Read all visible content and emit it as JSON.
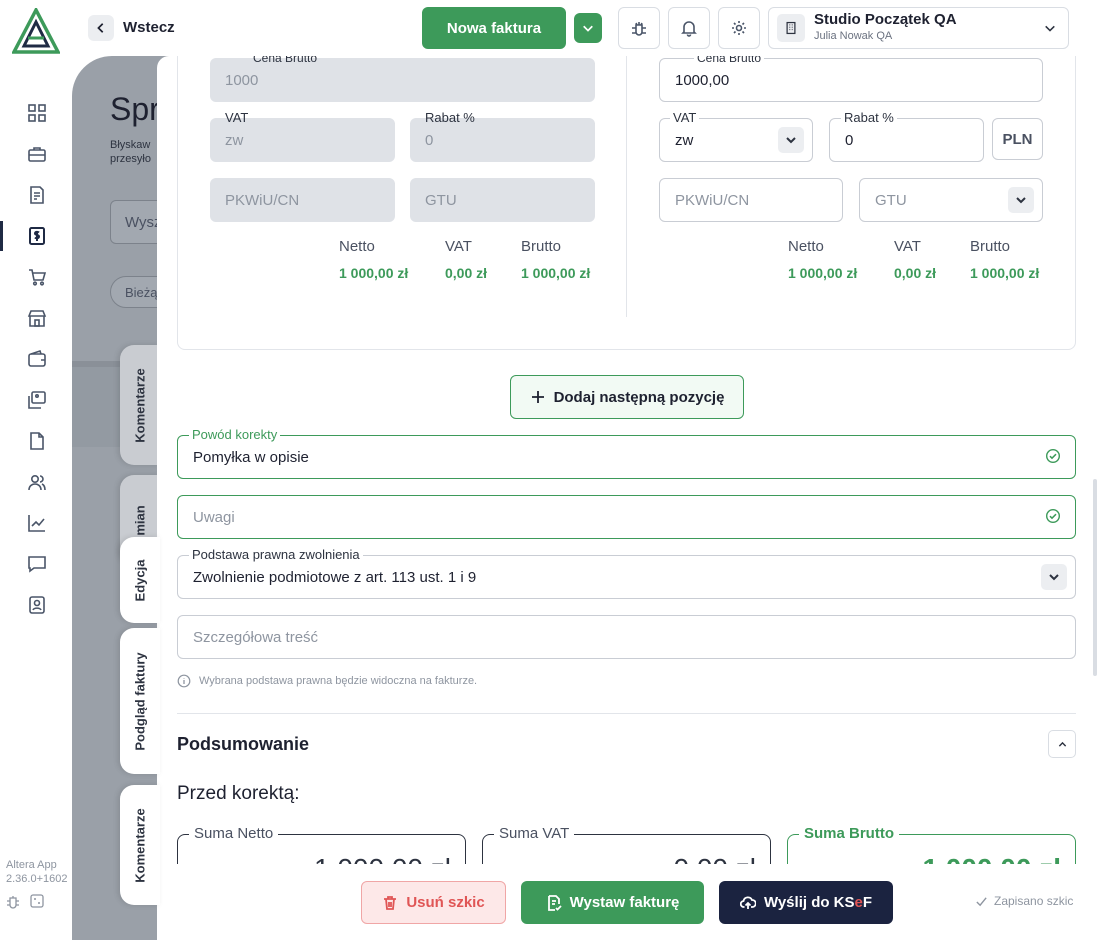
{
  "app": {
    "version_name": "Altera App",
    "version_number": "2.36.0+1602"
  },
  "topbar": {
    "back_label": "Wstecz",
    "new_invoice_label": "Nowa faktura",
    "company_name": "Studio Początek QA",
    "company_user": "Julia Nowak QA"
  },
  "background_page": {
    "title": "Spr",
    "subtitle_line1": "Błyskaw",
    "subtitle_line2": "przesyło",
    "search_placeholder": "Wysz",
    "filter_chip": "Bieżą"
  },
  "side_tabs": [
    "Komentarze",
    "mian",
    "Edycja",
    "Podgląd faktury",
    "Komentarze"
  ],
  "before": {
    "gross_price_label": "Cena Brutto",
    "gross_price_value": "1000",
    "vat_label": "VAT",
    "vat_value": "zw",
    "discount_label": "Rabat %",
    "discount_value": "0",
    "pkwiu_placeholder": "PKWiU/CN",
    "gtu_placeholder": "GTU",
    "net_label": "Netto",
    "net_value": "1 000,00 zł",
    "vat_sum_label": "VAT",
    "vat_sum_value": "0,00 zł",
    "gross_label": "Brutto",
    "gross_value": "1 000,00 zł"
  },
  "after": {
    "gross_price_label": "Cena Brutto",
    "gross_price_value": "1000,00",
    "vat_label": "VAT",
    "vat_value": "zw",
    "discount_label": "Rabat %",
    "discount_value": "0",
    "currency": "PLN",
    "pkwiu_placeholder": "PKWiU/CN",
    "gtu_placeholder": "GTU",
    "net_label": "Netto",
    "net_value": "1 000,00 zł",
    "vat_sum_label": "VAT",
    "vat_sum_value": "0,00 zł",
    "gross_label": "Brutto",
    "gross_value": "1 000,00 zł"
  },
  "add_item_label": "Dodaj następną pozycję",
  "correction": {
    "label": "Powód korekty",
    "value": "Pomyłka w opisie"
  },
  "notes": {
    "placeholder": "Uwagi"
  },
  "legal_basis": {
    "label": "Podstawa prawna zwolnienia",
    "value": "Zwolnienie podmiotowe z art. 113 ust. 1 i 9"
  },
  "details": {
    "placeholder": "Szczegółowa treść"
  },
  "hint": "Wybrana podstawa prawna będzie widoczna na fakturze.",
  "summary": {
    "title": "Podsumowanie",
    "before_title": "Przed korektą:",
    "net_label": "Suma Netto",
    "net_value": "1 000,00 zł",
    "vat_label": "Suma VAT",
    "vat_value": "0,00 zł",
    "gross_label": "Suma Brutto",
    "gross_value": "1 000,00 zł"
  },
  "actions": {
    "delete_label": "Usuń szkic",
    "issue_label": "Wystaw fakturę",
    "send_label_prefix": "Wyślij do KS",
    "send_label_e": "e",
    "send_label_suffix": "F",
    "saved_label": "Zapisano szkic"
  },
  "colors": {
    "green": "#3d9a5a",
    "navy": "#1f2a44",
    "danger": "#e05555",
    "danger_bg": "#fde8e8"
  }
}
